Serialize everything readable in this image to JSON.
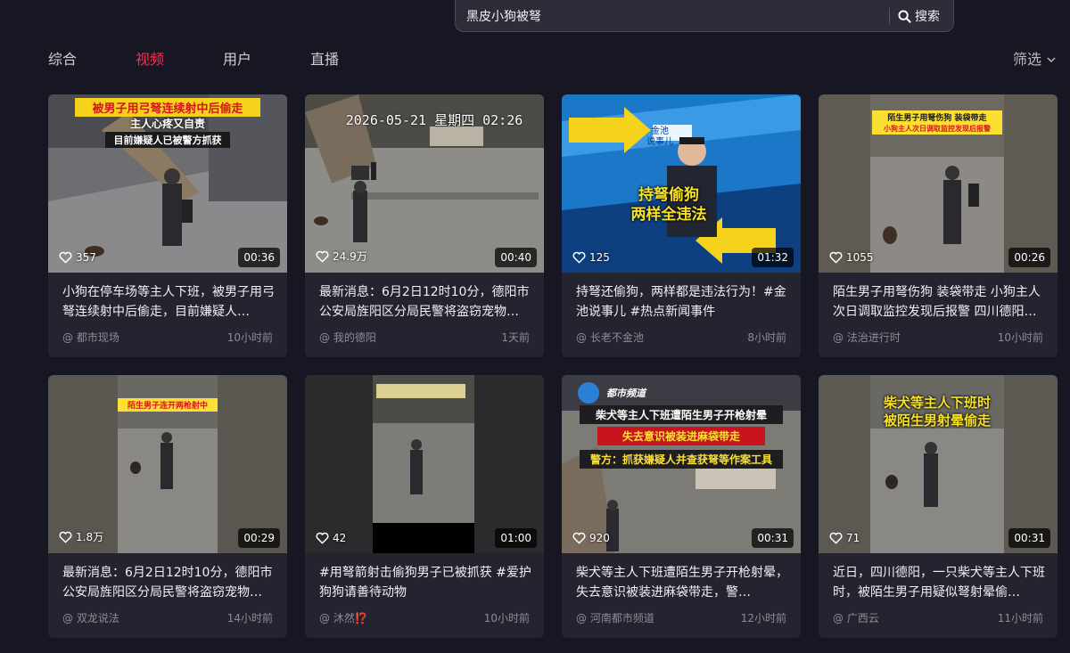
{
  "search": {
    "value": "黑皮小狗被弩",
    "button_label": "搜索"
  },
  "tabs": [
    "综合",
    "视频",
    "用户",
    "直播"
  ],
  "filter_label": "筛选",
  "videos": [
    {
      "likes": "357",
      "duration": "00:36",
      "description": "小狗在停车场等主人下班，被男子用弓弩连续射中后偷走，目前嫌疑人…",
      "author": "@ 都市现场",
      "time": "10小时前",
      "overlay": [
        "被男子用弓弩连续射中后偷走",
        "主人心疼又自责",
        "目前嫌疑人已被警方抓获"
      ]
    },
    {
      "likes": "24.9万",
      "duration": "00:40",
      "description": "最新消息：6月2日12时10分，德阳市公安局旌阳区分局民警将盗窃宠物…",
      "author": "@ 我的德阳",
      "time": "1天前",
      "overlay": [
        "2026-05-21 星期四 02:26"
      ]
    },
    {
      "likes": "125",
      "duration": "01:32",
      "description": "持弩还偷狗，两样都是违法行为！#金池说事儿 #热点新闻事件",
      "author": "@ 长老不金池",
      "time": "8小时前",
      "overlay": [
        "持弩偷狗",
        "两样全违法",
        "金池",
        "说事儿"
      ]
    },
    {
      "likes": "1055",
      "duration": "00:26",
      "description": "陌生男子用弩伤狗 装袋带走 小狗主人次日调取监控发现后报警 四川德阳…",
      "author": "@ 法治进行时",
      "time": "10小时前",
      "overlay": [
        "陌生男子用弩伤狗 装袋带走",
        "小狗主人次日调取监控发现后报警"
      ]
    },
    {
      "likes": "1.8万",
      "duration": "00:29",
      "description": "最新消息：6月2日12时10分，德阳市公安局旌阳区分局民警将盗窃宠物…",
      "author": "@ 双龙说法",
      "time": "14小时前",
      "overlay": [
        "陌生男子连开两枪射中"
      ]
    },
    {
      "likes": "42",
      "duration": "01:00",
      "description": "#用弩箭射击偷狗男子已被抓获 #爱护狗狗请善待动物",
      "author": "@ 沐然⁉️",
      "time": "10小时前",
      "overlay": []
    },
    {
      "likes": "920",
      "duration": "00:31",
      "description": "柴犬等主人下班遭陌生男子开枪射晕，失去意识被装进麻袋带走，警…",
      "author": "@ 河南都市频道",
      "time": "12小时前",
      "overlay": [
        "柴犬等主人下班遭陌生男子开枪射晕",
        "失去意识被装进麻袋带走",
        "警方：抓获嫌疑人并查获弩等作案工具",
        "都市频道"
      ]
    },
    {
      "likes": "71",
      "duration": "00:31",
      "description": "近日，四川德阳，一只柴犬等主人下班时，被陌生男子用疑似弩射晕偷…",
      "author": "@ 广西云",
      "time": "11小时前",
      "overlay": [
        "柴犬等主人下班时",
        "被陌生男射晕偷走"
      ]
    }
  ],
  "colors": {
    "accent": "#fe2c55",
    "card": "#23242f",
    "background": "#161722"
  }
}
